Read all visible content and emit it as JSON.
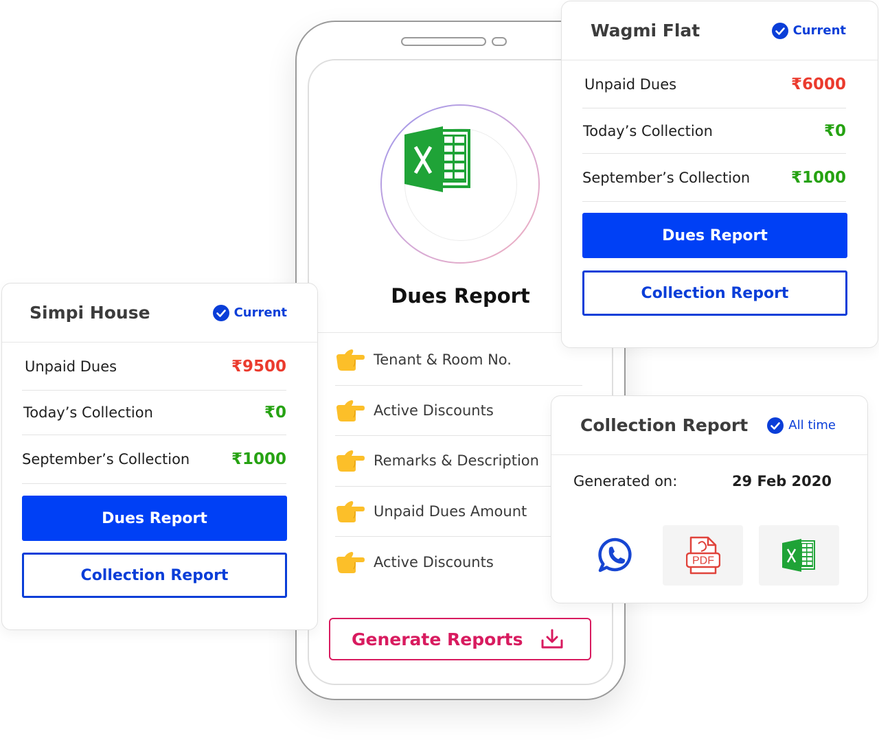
{
  "phone": {
    "title": "Dues Report",
    "features": [
      {
        "label": "Tenant & Room No.",
        "icon": "pointing-hand-icon"
      },
      {
        "label": "Active Discounts",
        "icon": "pointing-hand-icon"
      },
      {
        "label": "Remarks & Description",
        "icon": "pointing-hand-icon"
      },
      {
        "label": "Unpaid Dues Amount",
        "icon": "pointing-hand-icon"
      },
      {
        "label": "Active Discounts",
        "icon": "pointing-hand-icon"
      }
    ],
    "generate_label": "Generate Reports"
  },
  "simpi": {
    "title": "Simpi House",
    "badge": "Current",
    "unpaid_label": "Unpaid Dues",
    "unpaid_value": "₹9500",
    "today_label": "Today’s Collection",
    "today_value": "₹0",
    "month_label": "September’s Collection",
    "month_value": "₹1000",
    "dues_button": "Dues Report",
    "collection_button": "Collection Report"
  },
  "wagmi": {
    "title": "Wagmi Flat",
    "badge": "Current",
    "unpaid_label": "Unpaid Dues",
    "unpaid_value": "₹6000",
    "today_label": "Today’s Collection",
    "today_value": "₹0",
    "month_label": "September’s Collection",
    "month_value": "₹1000",
    "dues_button": "Dues Report",
    "collection_button": "Collection Report"
  },
  "collection": {
    "title": "Collection Report",
    "badge": "All time",
    "generated_label": "Generated on:",
    "generated_date": "29 Feb 2020",
    "share_options": [
      "whatsapp-icon",
      "pdf-icon",
      "excel-icon"
    ],
    "pdf_text": "PDF"
  },
  "colors": {
    "primary": "#0040f5",
    "brand_blue": "#0a3ed8",
    "generate": "#d81b5f",
    "due_red": "#eb3b2e",
    "collection_green": "#26a212",
    "excel_green": "#1fa337"
  }
}
